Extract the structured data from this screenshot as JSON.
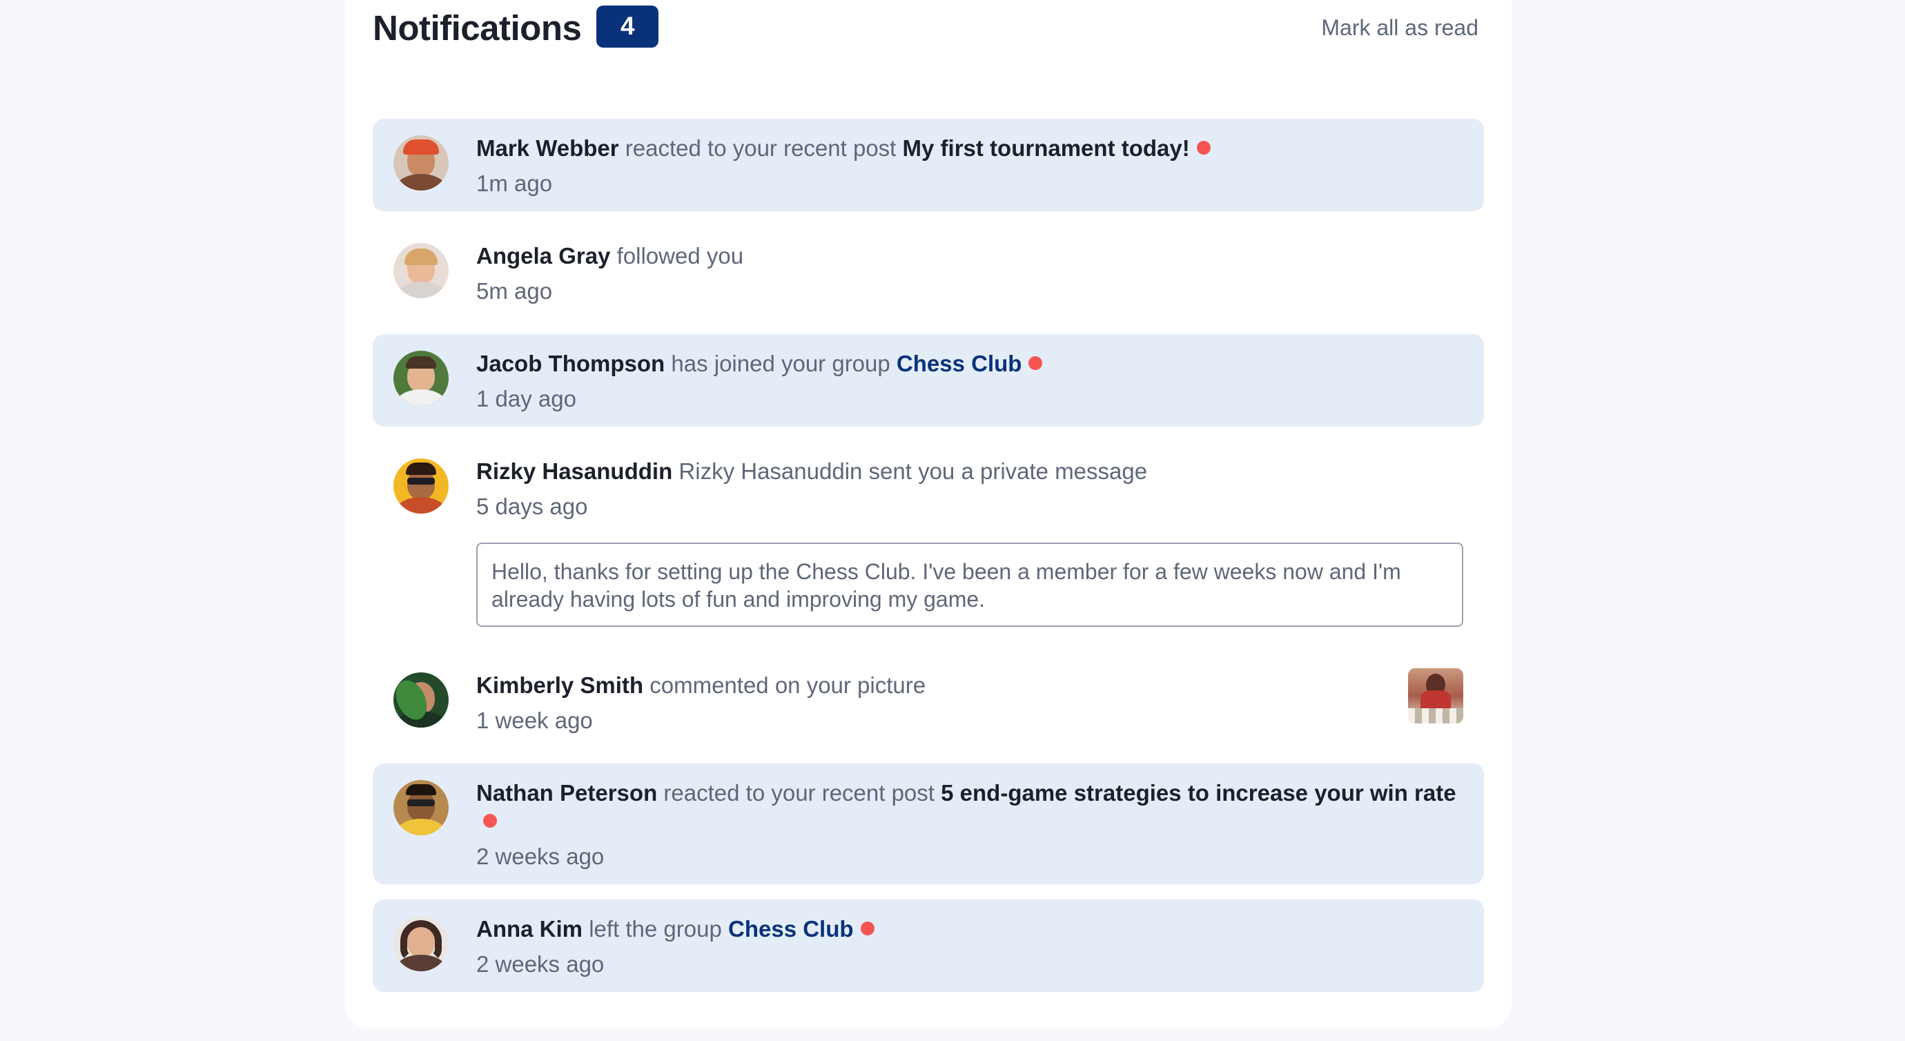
{
  "header": {
    "title": "Notifications",
    "unread_count": "4",
    "mark_all_label": "Mark all as read"
  },
  "colors": {
    "badge": "#0a327b",
    "unread_bg": "#e4edf7",
    "dot": "#f65552",
    "group_link": "#0a327b"
  },
  "notifications": [
    {
      "user": "Mark Webber",
      "action": "reacted to your recent post",
      "target": "My first tournament today!",
      "time": "1m ago",
      "unread": true,
      "avatar_icon": "avatar-mark-webber"
    },
    {
      "user": "Angela Gray",
      "action": "followed you",
      "time": "5m ago",
      "unread": false,
      "avatar_icon": "avatar-angela-gray"
    },
    {
      "user": "Jacob Thompson",
      "action": "has joined your group",
      "target": "Chess Club",
      "time": "1 day ago",
      "unread": true,
      "avatar_icon": "avatar-jacob-thompson"
    },
    {
      "user": "Rizky Hasanuddin",
      "action": "Rizky Hasanuddin sent you a private message",
      "time": "5 days ago",
      "message": "Hello, thanks for setting up the Chess Club. I've been a member for a few weeks now and I'm already having lots of fun and improving my game.",
      "unread": false,
      "avatar_icon": "avatar-rizky-hasanuddin"
    },
    {
      "user": "Kimberly Smith",
      "action": "commented on your picture",
      "time": "1 week ago",
      "unread": false,
      "avatar_icon": "avatar-kimberly-smith",
      "thumbnail_icon": "chess-picture-thumbnail"
    },
    {
      "user": "Nathan Peterson",
      "action": "reacted to your recent post",
      "target": "5 end-game strategies to increase your win rate",
      "time": "2 weeks ago",
      "unread": true,
      "avatar_icon": "avatar-nathan-peterson"
    },
    {
      "user": "Anna Kim",
      "action": "left the group",
      "target": "Chess Club",
      "time": "2 weeks ago",
      "unread": true,
      "avatar_icon": "avatar-anna-kim"
    }
  ]
}
